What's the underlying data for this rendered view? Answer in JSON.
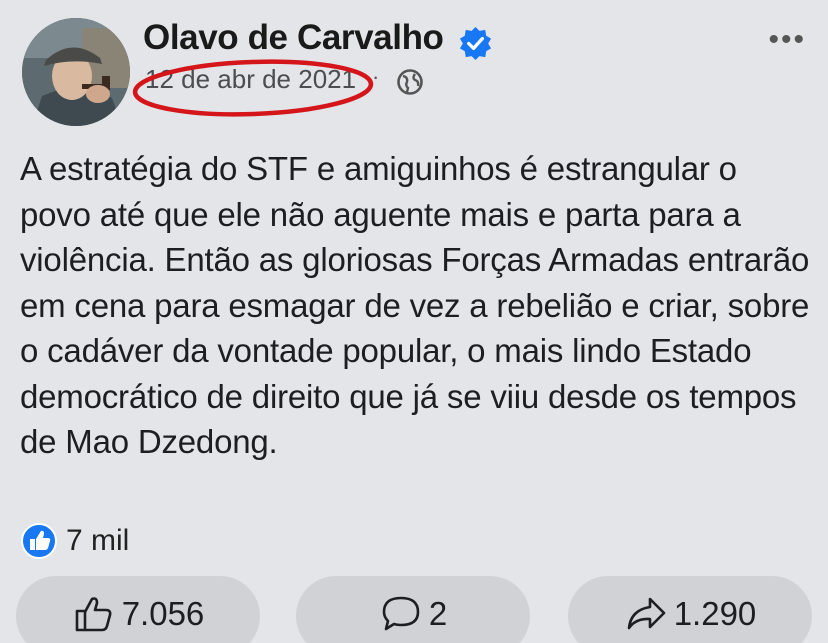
{
  "post": {
    "author": "Olavo de Carvalho",
    "date": "12 de abr de 2021",
    "separator": "·",
    "more_label": "•••",
    "body": "A estratégia do STF e amiguinhos é estrangular o povo até que ele não aguente mais e parta para a violência. Então as gloriosas Forças Armadas entrarão em cena para esmagar de vez a rebelião e criar, sobre o cadáver da vontade popular, o mais lindo Estado democrático de direito que já se viiu desde os tempos de Mao Dzedong.",
    "reactions_count": "7 mil",
    "likes": "7.056",
    "comments": "2",
    "shares": "1.290"
  },
  "icons": {
    "verified": "verified-badge-icon",
    "audience": "globe-icon",
    "reaction": "like-badge-icon",
    "like": "thumbs-up-icon",
    "comment": "comment-bubble-icon",
    "share": "share-arrow-icon"
  },
  "colors": {
    "facebook_blue": "#1877f2",
    "highlight_red": "#d4161b",
    "background": "#e4e5e9",
    "button_bg": "#d0d2d6"
  }
}
